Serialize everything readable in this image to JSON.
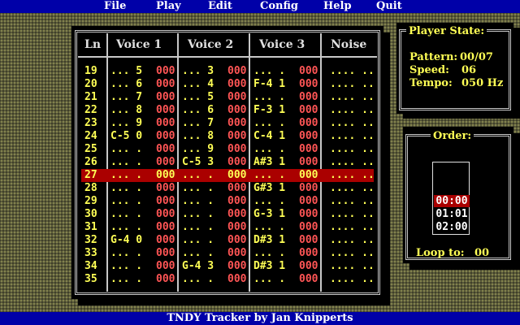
{
  "menu": {
    "items": [
      "File",
      "Play",
      "Edit",
      "Config",
      "Help",
      "Quit"
    ]
  },
  "status_bar": {
    "text": "TNDY Tracker by Jan Knipperts"
  },
  "pattern_editor": {
    "headers": {
      "ln": "Ln",
      "voice1": "Voice 1",
      "voice2": "Voice 2",
      "voice3": "Voice 3",
      "noise": "Noise"
    },
    "highlight_row": "27",
    "rows": [
      {
        "ln": "19",
        "v1": "... 5",
        "v1fx": "000",
        "v2": "... 3",
        "v2fx": "000",
        "v3": "... .",
        "v3fx": "000",
        "noise": ".... .."
      },
      {
        "ln": "20",
        "v1": "... 6",
        "v1fx": "000",
        "v2": "... 4",
        "v2fx": "000",
        "v3": "F-4 1",
        "v3fx": "000",
        "noise": ".... .."
      },
      {
        "ln": "21",
        "v1": "... 7",
        "v1fx": "000",
        "v2": "... 5",
        "v2fx": "000",
        "v3": "... .",
        "v3fx": "000",
        "noise": ".... .."
      },
      {
        "ln": "22",
        "v1": "... 8",
        "v1fx": "000",
        "v2": "... 6",
        "v2fx": "000",
        "v3": "F-3 1",
        "v3fx": "000",
        "noise": ".... .."
      },
      {
        "ln": "23",
        "v1": "... 9",
        "v1fx": "000",
        "v2": "... 7",
        "v2fx": "000",
        "v3": "... .",
        "v3fx": "000",
        "noise": ".... .."
      },
      {
        "ln": "24",
        "v1": "C-5 0",
        "v1fx": "000",
        "v2": "... 8",
        "v2fx": "000",
        "v3": "C-4 1",
        "v3fx": "000",
        "noise": ".... .."
      },
      {
        "ln": "25",
        "v1": "... .",
        "v1fx": "000",
        "v2": "... 9",
        "v2fx": "000",
        "v3": "... .",
        "v3fx": "000",
        "noise": ".... .."
      },
      {
        "ln": "26",
        "v1": "... .",
        "v1fx": "000",
        "v2": "C-5 3",
        "v2fx": "000",
        "v3": "A#3 1",
        "v3fx": "000",
        "noise": ".... .."
      },
      {
        "ln": "27",
        "v1": "... .",
        "v1fx": "000",
        "v2": "... .",
        "v2fx": "000",
        "v3": "... .",
        "v3fx": "000",
        "noise": ".... .."
      },
      {
        "ln": "28",
        "v1": "... .",
        "v1fx": "000",
        "v2": "... .",
        "v2fx": "000",
        "v3": "G#3 1",
        "v3fx": "000",
        "noise": ".... .."
      },
      {
        "ln": "29",
        "v1": "... .",
        "v1fx": "000",
        "v2": "... .",
        "v2fx": "000",
        "v3": "... .",
        "v3fx": "000",
        "noise": ".... .."
      },
      {
        "ln": "30",
        "v1": "... .",
        "v1fx": "000",
        "v2": "... .",
        "v2fx": "000",
        "v3": "G-3 1",
        "v3fx": "000",
        "noise": ".... .."
      },
      {
        "ln": "31",
        "v1": "... .",
        "v1fx": "000",
        "v2": "... .",
        "v2fx": "000",
        "v3": "... .",
        "v3fx": "000",
        "noise": ".... .."
      },
      {
        "ln": "32",
        "v1": "G-4 0",
        "v1fx": "000",
        "v2": "... .",
        "v2fx": "000",
        "v3": "D#3 1",
        "v3fx": "000",
        "noise": ".... .."
      },
      {
        "ln": "33",
        "v1": "... .",
        "v1fx": "000",
        "v2": "... .",
        "v2fx": "000",
        "v3": "... .",
        "v3fx": "000",
        "noise": ".... .."
      },
      {
        "ln": "34",
        "v1": "... .",
        "v1fx": "000",
        "v2": "G-4 3",
        "v2fx": "000",
        "v3": "D#3 1",
        "v3fx": "000",
        "noise": ".... .."
      },
      {
        "ln": "35",
        "v1": "... .",
        "v1fx": "000",
        "v2": "... .",
        "v2fx": "000",
        "v3": "... .",
        "v3fx": "000",
        "noise": ".... .."
      }
    ]
  },
  "player_state": {
    "title": "Player State:",
    "pattern_label": "Pattern:",
    "pattern_value": "00/07",
    "speed_label": "Speed:",
    "speed_value": "06",
    "tempo_label": "Tempo:",
    "tempo_value": "050 Hz"
  },
  "order": {
    "title": "Order:",
    "entries": [
      "00:00",
      "01:01",
      "02:00"
    ],
    "current_index": 0,
    "loop_label": "Loop to:",
    "loop_value": "00"
  },
  "colors": {
    "menubar": "#0000a8",
    "highlight": "#aa0000",
    "text_yellow": "#ffff55",
    "text_red": "#ff5555",
    "frame": "#c8c8c8"
  }
}
